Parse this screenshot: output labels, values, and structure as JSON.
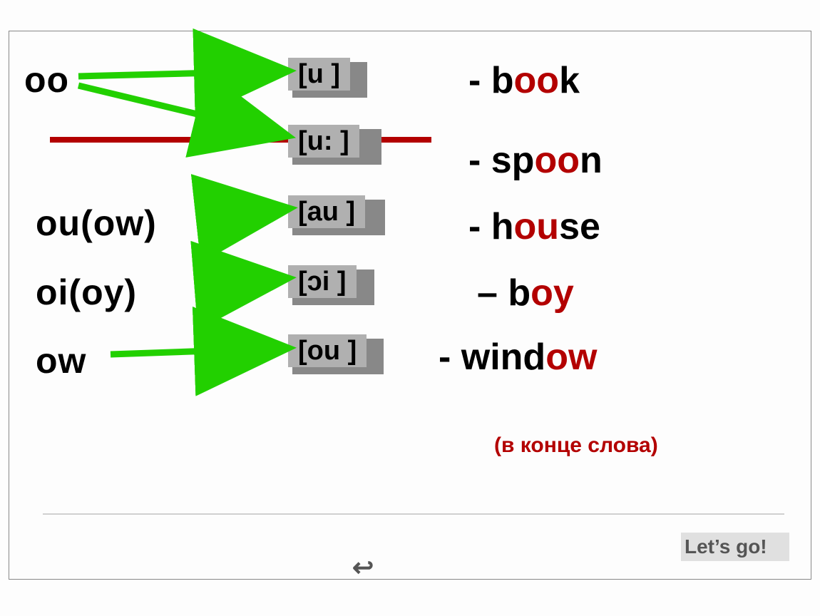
{
  "combos": {
    "oo": "oo",
    "ouow": "ou(ow)",
    "oioy": "oi(oy)",
    "ow": "ow"
  },
  "sounds": {
    "u_short": "[u ]",
    "u_long": "[u: ]",
    "au": "[au ]",
    "oi": "[ɔi ]",
    "ou": "[ou ]"
  },
  "examples": {
    "book": {
      "pre": "- b",
      "hl": "oo",
      "post": "k"
    },
    "spoon": {
      "pre": "- sp",
      "hl": "oo",
      "post": "n"
    },
    "house": {
      "pre": "- h",
      "hl": "ou",
      "post": "se"
    },
    "boy": {
      "pre": "– b",
      "hl": "oy",
      "post": ""
    },
    "window": {
      "pre": "- wind",
      "hl": "ow",
      "post": ""
    }
  },
  "note": "(в конце слова)",
  "lets_go": "Let’s go!",
  "return_icon": "↩"
}
